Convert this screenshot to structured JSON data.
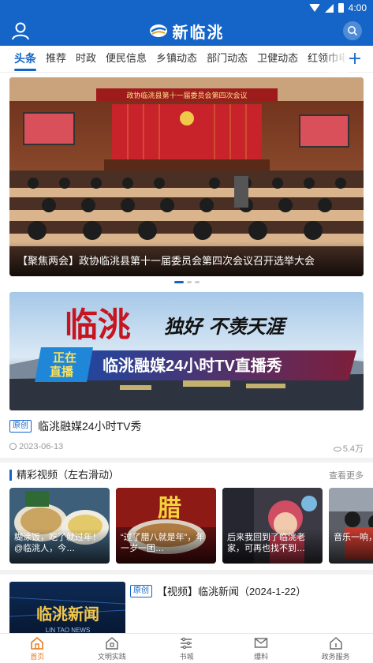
{
  "status_bar": {
    "time": "4:00"
  },
  "header": {
    "app_name": "新临洮"
  },
  "tabs": [
    {
      "label": "头条",
      "active": true
    },
    {
      "label": "推荐"
    },
    {
      "label": "时政"
    },
    {
      "label": "便民信息"
    },
    {
      "label": "乡镇动态"
    },
    {
      "label": "部门动态"
    },
    {
      "label": "卫健动态"
    },
    {
      "label": "红领巾电台"
    }
  ],
  "carousel": {
    "caption": "【聚焦两会】政协临洮县第十一届委员会第四次会议召开选举大会",
    "banner_text": "政协临洮县第十一届委员会第四次会议",
    "total_slides": 3,
    "active_slide": 0
  },
  "feature": {
    "calligraphy_main": "临洮",
    "calligraphy_slogan": "独好   不羡天涯",
    "live_badge_line1": "正在",
    "live_badge_line2": "直播",
    "live_banner": "临洮融媒24小时TV直播秀",
    "tag": "原创",
    "title": "临洮融媒24小时TV秀",
    "date": "2023-06-13",
    "views": "5.4万"
  },
  "video_section": {
    "title": "精彩视频（左右滑动）",
    "more": "查看更多",
    "videos": [
      {
        "text": "糊涂饭，吃了就过年！@临洮人，今…"
      },
      {
        "text": "“过了腊八就是年”，年一岁一团…",
        "overlay": "腊"
      },
      {
        "text": "后来我回到了临洮老家，可再也找不到…"
      },
      {
        "text": "音乐一响，就来了！"
      }
    ]
  },
  "news_item": {
    "tag": "原创",
    "title": "【视频】临洮新闻（2024-1-22）",
    "thumb_text": "临洮新闻",
    "thumb_sub": "LIN TAO NEWS"
  },
  "bottom_nav": [
    {
      "label": "首页",
      "icon": "home-icon",
      "active": true
    },
    {
      "label": "文明实践",
      "icon": "civilization-icon"
    },
    {
      "label": "书城",
      "icon": "bookstore-icon"
    },
    {
      "label": "爆料",
      "icon": "mail-icon"
    },
    {
      "label": "政务服务",
      "icon": "gov-service-icon"
    }
  ],
  "colors": {
    "brand_blue": "#1565c8",
    "active_orange": "#e87b1e"
  }
}
